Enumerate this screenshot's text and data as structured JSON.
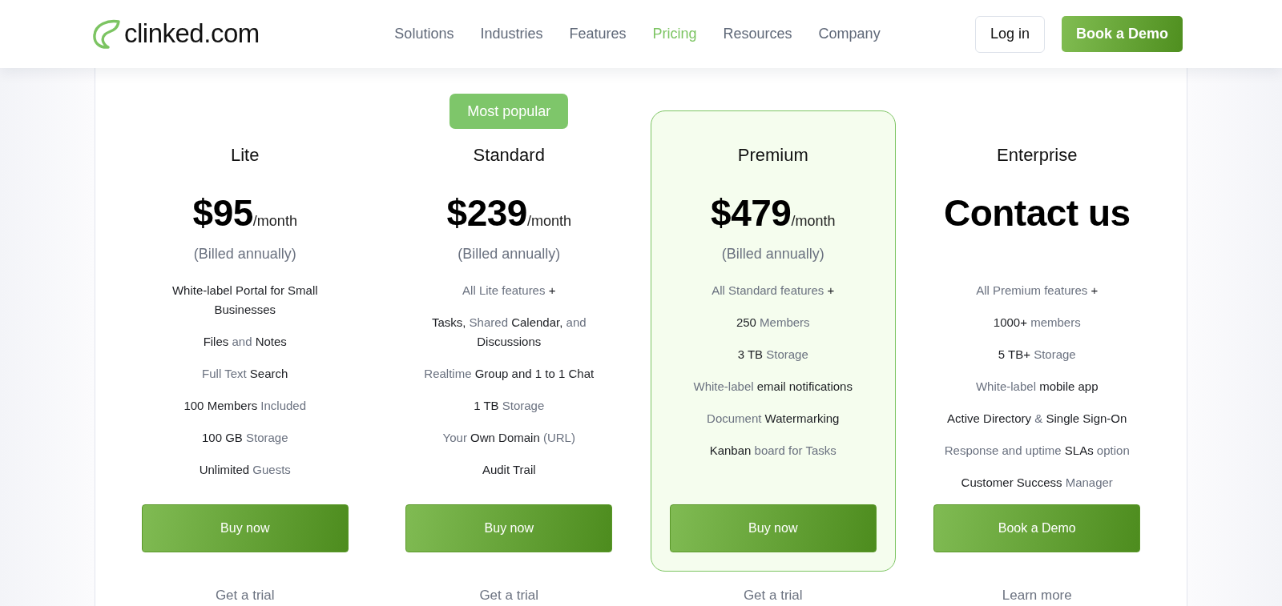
{
  "header": {
    "logo": {
      "text": "clinked.com"
    },
    "nav": [
      {
        "label": "Solutions",
        "selected": false
      },
      {
        "label": "Industries",
        "selected": false
      },
      {
        "label": "Features",
        "selected": false
      },
      {
        "label": "Pricing",
        "selected": true
      },
      {
        "label": "Resources",
        "selected": false
      },
      {
        "label": "Company",
        "selected": false
      }
    ],
    "buttons": [
      {
        "label": "Log in",
        "kind": "outline"
      },
      {
        "label": "Book a Demo",
        "kind": "primary"
      }
    ]
  },
  "plans": [
    {
      "name": "Lite",
      "highlighted": false,
      "price": {
        "amount": "$95",
        "period": "/month",
        "note": "(Billed annually)"
      },
      "features": [
        "**White-label Portal for Small Businesses**",
        "**Files** and **Notes**",
        "Full Text **Search**",
        "**100 Members** Included",
        "**100 GB** Storage",
        "**Unlimited** Guests"
      ],
      "button": "Buy now",
      "link": "Get a trial"
    },
    {
      "name": "Standard",
      "badge": "Most popular",
      "highlighted": false,
      "price": {
        "amount": "$239",
        "period": "/month",
        "note": "(Billed annually)"
      },
      "features": [
        "All Lite features **+**",
        "**Tasks,** Shared **Calendar,** and **Discussions**",
        "Realtime **Group and 1 to 1 Chat**",
        "**1 TB** Storage",
        "Your **Own Domain** (URL)",
        "**Audit Trail**"
      ],
      "button": "Buy now",
      "link": "Get a trial"
    },
    {
      "name": "Premium",
      "highlighted": true,
      "price": {
        "amount": "$479",
        "period": "/month",
        "note": "(Billed annually)"
      },
      "features": [
        "All Standard features **+**",
        "**250** Members",
        "**3 TB** Storage",
        "White-label **email notifications**",
        "Document **Watermarking**",
        "**Kanban** board for Tasks"
      ],
      "button": "Buy now",
      "link": "Get a trial"
    },
    {
      "name": "Enterprise",
      "highlighted": false,
      "price": {
        "amount": "Contact us"
      },
      "features": [
        "All Premium features **+**",
        "**1000+** members",
        "**5 TB+** Storage",
        "White-label **mobile app**",
        "**Active Directory** & **Single Sign-On**",
        "Response and uptime **SLAs** option",
        "**Customer Success** Manager"
      ],
      "button": "Book a Demo",
      "link": "Learn more"
    }
  ]
}
